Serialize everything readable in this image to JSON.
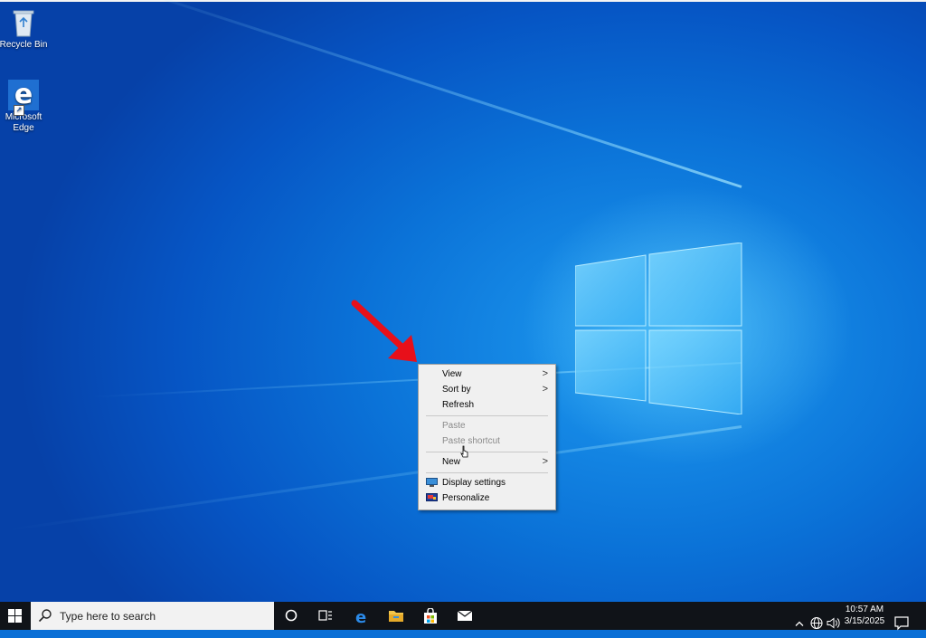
{
  "desktop": {
    "icons": [
      {
        "label": "Recycle Bin",
        "icon": "recycle-bin-icon"
      },
      {
        "label": "Microsoft\nEdge",
        "label_line1": "Microsoft",
        "label_line2": "Edge",
        "icon": "edge-icon"
      }
    ]
  },
  "context_menu": {
    "items": [
      {
        "label": "View",
        "has_submenu": true,
        "enabled": true
      },
      {
        "label": "Sort by",
        "has_submenu": true,
        "enabled": true
      },
      {
        "label": "Refresh",
        "enabled": true
      },
      {
        "label": "Paste",
        "enabled": false
      },
      {
        "label": "Paste shortcut",
        "enabled": false
      },
      {
        "label": "New",
        "has_submenu": true,
        "enabled": true
      },
      {
        "label": "Display settings",
        "enabled": true,
        "icon": "display-settings-icon"
      },
      {
        "label": "Personalize",
        "enabled": true,
        "icon": "personalize-icon"
      }
    ],
    "submenu_glyph": ">"
  },
  "taskbar": {
    "search_placeholder": "Type here to search",
    "pinned": [
      "cortana-icon",
      "task-view-icon",
      "edge-icon",
      "file-explorer-icon",
      "store-icon",
      "mail-icon"
    ],
    "tray": [
      "chevron-up-icon",
      "network-icon",
      "volume-icon"
    ],
    "clock_time": "10:57 AM",
    "clock_date": "3/15/2025",
    "notification_icon": "action-center-icon"
  },
  "colors": {
    "accent_arrow": "#e8101a",
    "taskbar_bg": "#101318",
    "menu_bg": "#f0f0f0"
  }
}
